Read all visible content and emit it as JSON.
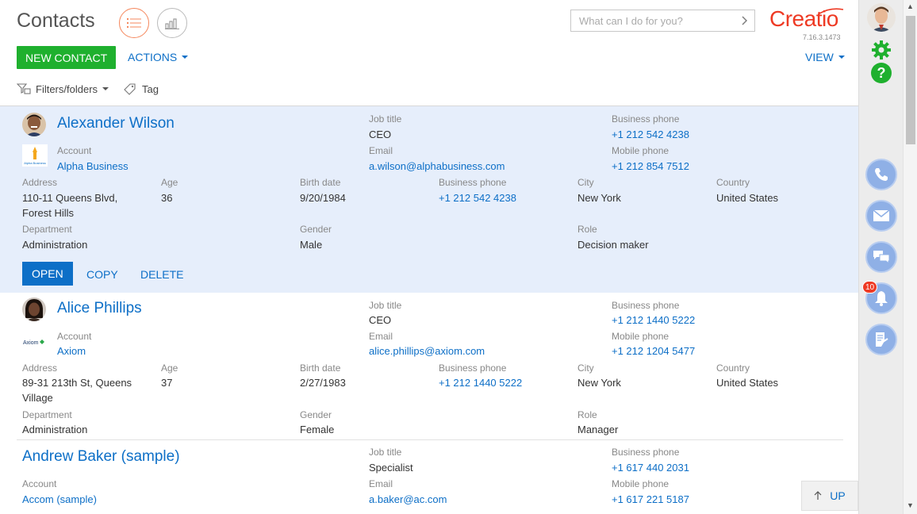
{
  "header": {
    "title": "Contacts",
    "search_placeholder": "What can I do for you?",
    "logo_text": "Creatio",
    "version": "7.16.3.1473"
  },
  "toolbar": {
    "new_contact_label": "NEW CONTACT",
    "actions_label": "ACTIONS",
    "view_label": "VIEW"
  },
  "filters": {
    "filters_label": "Filters/folders",
    "tag_label": "Tag"
  },
  "labels": {
    "job_title": "Job title",
    "business_phone": "Business phone",
    "account": "Account",
    "email": "Email",
    "mobile_phone": "Mobile phone",
    "address": "Address",
    "age": "Age",
    "birth_date": "Birth date",
    "city": "City",
    "country": "Country",
    "department": "Department",
    "gender": "Gender",
    "role": "Role"
  },
  "records": [
    {
      "name": "Alexander Wilson",
      "job_title": "CEO",
      "business_phone": "+1 212 542 4238",
      "account": "Alpha Business",
      "email": "a.wilson@alphabusiness.com",
      "mobile_phone": "+1 212 854 7512",
      "address": "110-11 Queens Blvd, Forest Hills",
      "age": "36",
      "birth_date": "9/20/1984",
      "business_phone_2": "+1 212 542 4238",
      "city": "New York",
      "country": "United States",
      "department": "Administration",
      "gender": "Male",
      "role": "Decision maker",
      "account_logo_text": "Alpha Business"
    },
    {
      "name": "Alice Phillips",
      "job_title": "CEO",
      "business_phone": "+1 212 1440 5222",
      "account": "Axiom",
      "email": "alice.phillips@axiom.com",
      "mobile_phone": "+1 212 1204 5477",
      "address": "89-31 213th St, Queens Village",
      "age": "37",
      "birth_date": "2/27/1983",
      "business_phone_2": "+1 212 1440 5222",
      "city": "New York",
      "country": "United States",
      "department": "Administration",
      "gender": "Female",
      "role": "Manager",
      "account_logo_text": "Axiom"
    },
    {
      "name": "Andrew Baker (sample)",
      "job_title": "Specialist",
      "business_phone": "+1 617 440 2031",
      "account": "Accom (sample)",
      "email": "a.baker@ac.com",
      "mobile_phone": "+1 617 221 5187"
    }
  ],
  "row_actions": {
    "open": "OPEN",
    "copy": "COPY",
    "delete": "DELETE"
  },
  "scroll_up_label": "UP",
  "notifications_count": "10",
  "colors": {
    "accent_blue": "#0d6fc7",
    "new_button_green": "#1fb02e",
    "logo_red": "#ee3a24",
    "selected_row": "#e6eefb",
    "comm_button": "#8fb0e6"
  }
}
